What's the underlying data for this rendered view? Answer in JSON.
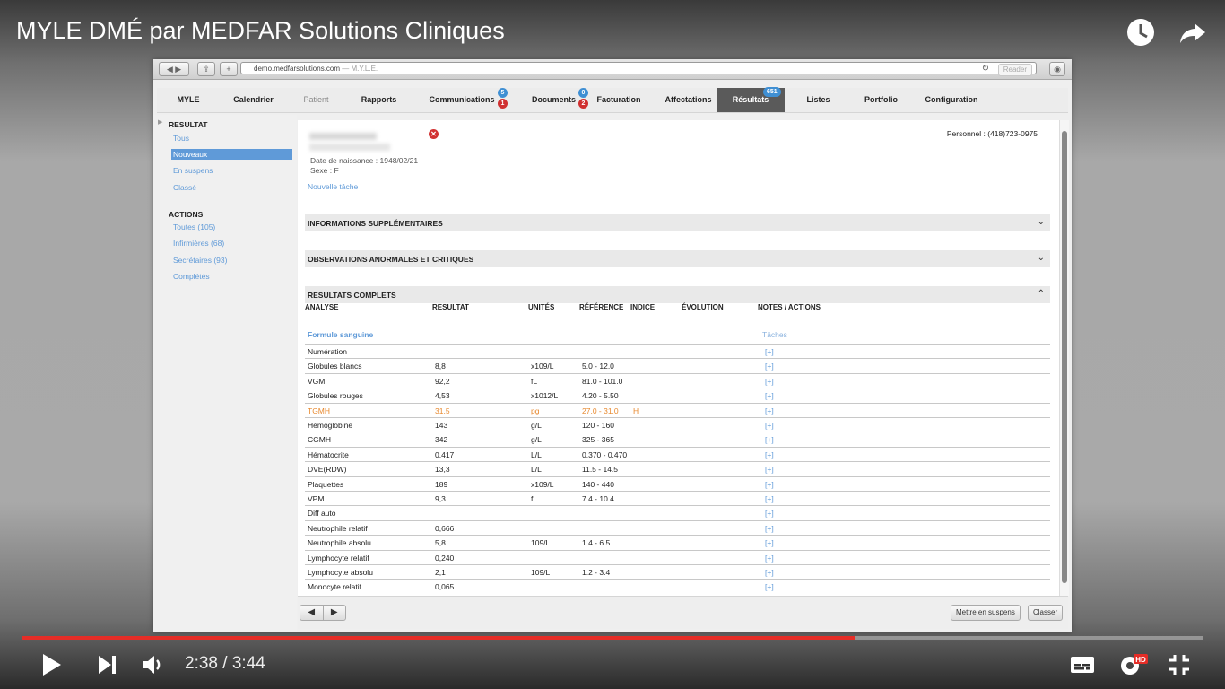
{
  "video": {
    "title": "MYLE DMÉ par MEDFAR Solutions Cliniques",
    "current_time": "2:38",
    "separator": "/",
    "duration": "3:44",
    "progress_fraction": 0.705,
    "hd_badge": "HD",
    "icons": [
      "clock-icon",
      "share-icon",
      "play-icon",
      "next-icon",
      "volume-icon",
      "subtitles-icon",
      "settings-icon",
      "exit-fullscreen-icon"
    ]
  },
  "browser": {
    "url": "demo.medfarsolutions.com",
    "url_suffix": "— M.Y.L.E.",
    "reader_label": "Reader"
  },
  "nav": {
    "items": [
      {
        "label": "MYLE"
      },
      {
        "label": "Calendrier"
      },
      {
        "label": "Patient"
      },
      {
        "label": "Rapports"
      },
      {
        "label": "Communications",
        "badges": [
          "5",
          "1"
        ]
      },
      {
        "label": "Documents",
        "badges": [
          "0",
          "2"
        ]
      },
      {
        "label": "Facturation"
      },
      {
        "label": "Affectations"
      },
      {
        "label": "Résultats",
        "badges": [
          "651"
        ]
      },
      {
        "label": "Listes"
      },
      {
        "label": "Portfolio"
      },
      {
        "label": "Configuration"
      }
    ]
  },
  "sidebar": {
    "resultat_heading": "RESULTAT",
    "resultat_items": [
      "Tous",
      "Nouveaux",
      "En suspens",
      "Classé"
    ],
    "actions_heading": "ACTIONS",
    "action_items": [
      "Toutes (105)",
      "Infirmières (68)",
      "Secrétaires (93)",
      "Complétés"
    ]
  },
  "patient": {
    "phone": "Personnel : (418)723-0975",
    "dob_label": "Date de naissance :",
    "dob": "1948/02/21",
    "sex_label": "Sexe :",
    "sex": "F",
    "new_task": "Nouvelle tâche"
  },
  "sections": {
    "info": "INFORMATIONS SUPPLÉMENTAIRES",
    "obs": "OBSERVATIONS ANORMALES ET CRITIQUES",
    "results": "RESULTATS COMPLETS"
  },
  "table": {
    "headers": [
      "ANALYSE",
      "RESULTAT",
      "UNITÉS",
      "RÉFÉRENCE",
      "INDICE",
      "ÉVOLUTION",
      "NOTES / ACTIONS"
    ],
    "group": "Formule sanguine",
    "tasks_label": "Tâches",
    "action_label": "[+]",
    "rows": [
      {
        "analyse": "Numération",
        "resultat": "",
        "unites": "",
        "reference": "",
        "indice": ""
      },
      {
        "analyse": "Globules blancs",
        "resultat": "8,8",
        "unites": "x109/L",
        "reference": "5.0 - 12.0",
        "indice": ""
      },
      {
        "analyse": "VGM",
        "resultat": "92,2",
        "unites": "fL",
        "reference": "81.0 - 101.0",
        "indice": ""
      },
      {
        "analyse": "Globules rouges",
        "resultat": "4,53",
        "unites": "x1012/L",
        "reference": "4.20 - 5.50",
        "indice": ""
      },
      {
        "analyse": "TGMH",
        "resultat": "31,5",
        "unites": "pg",
        "reference": "27.0 - 31.0",
        "indice": "H",
        "flag": true
      },
      {
        "analyse": "Hémoglobine",
        "resultat": "143",
        "unites": "g/L",
        "reference": "120 - 160",
        "indice": ""
      },
      {
        "analyse": "CGMH",
        "resultat": "342",
        "unites": "g/L",
        "reference": "325 - 365",
        "indice": ""
      },
      {
        "analyse": "Hématocrite",
        "resultat": "0,417",
        "unites": "L/L",
        "reference": "0.370 - 0.470",
        "indice": ""
      },
      {
        "analyse": "DVE(RDW)",
        "resultat": "13,3",
        "unites": "L/L",
        "reference": "11.5 - 14.5",
        "indice": ""
      },
      {
        "analyse": "Plaquettes",
        "resultat": "189",
        "unites": "x109/L",
        "reference": "140 - 440",
        "indice": ""
      },
      {
        "analyse": "VPM",
        "resultat": "9,3",
        "unites": "fL",
        "reference": "7.4 - 10.4",
        "indice": ""
      },
      {
        "analyse": "Diff auto",
        "resultat": "",
        "unites": "",
        "reference": "",
        "indice": ""
      },
      {
        "analyse": "Neutrophile relatif",
        "resultat": "0,666",
        "unites": "",
        "reference": "",
        "indice": ""
      },
      {
        "analyse": "Neutrophile absolu",
        "resultat": "5,8",
        "unites": "109/L",
        "reference": "1.4 - 6.5",
        "indice": ""
      },
      {
        "analyse": "Lymphocyte relatif",
        "resultat": "0,240",
        "unites": "",
        "reference": "",
        "indice": ""
      },
      {
        "analyse": "Lymphocyte absolu",
        "resultat": "2,1",
        "unites": "109/L",
        "reference": "1.2 - 3.4",
        "indice": ""
      },
      {
        "analyse": "Monocyte relatif",
        "resultat": "0,065",
        "unites": "",
        "reference": "",
        "indice": ""
      }
    ]
  },
  "bottom": {
    "prev": "◀",
    "next": "▶",
    "suspend_button": "Mettre en suspens",
    "classify_button": "Classer"
  },
  "colors": {
    "accent_blue": "#5f9ad8",
    "flag_orange": "#e8892e",
    "progress_red": "#e52d27"
  }
}
